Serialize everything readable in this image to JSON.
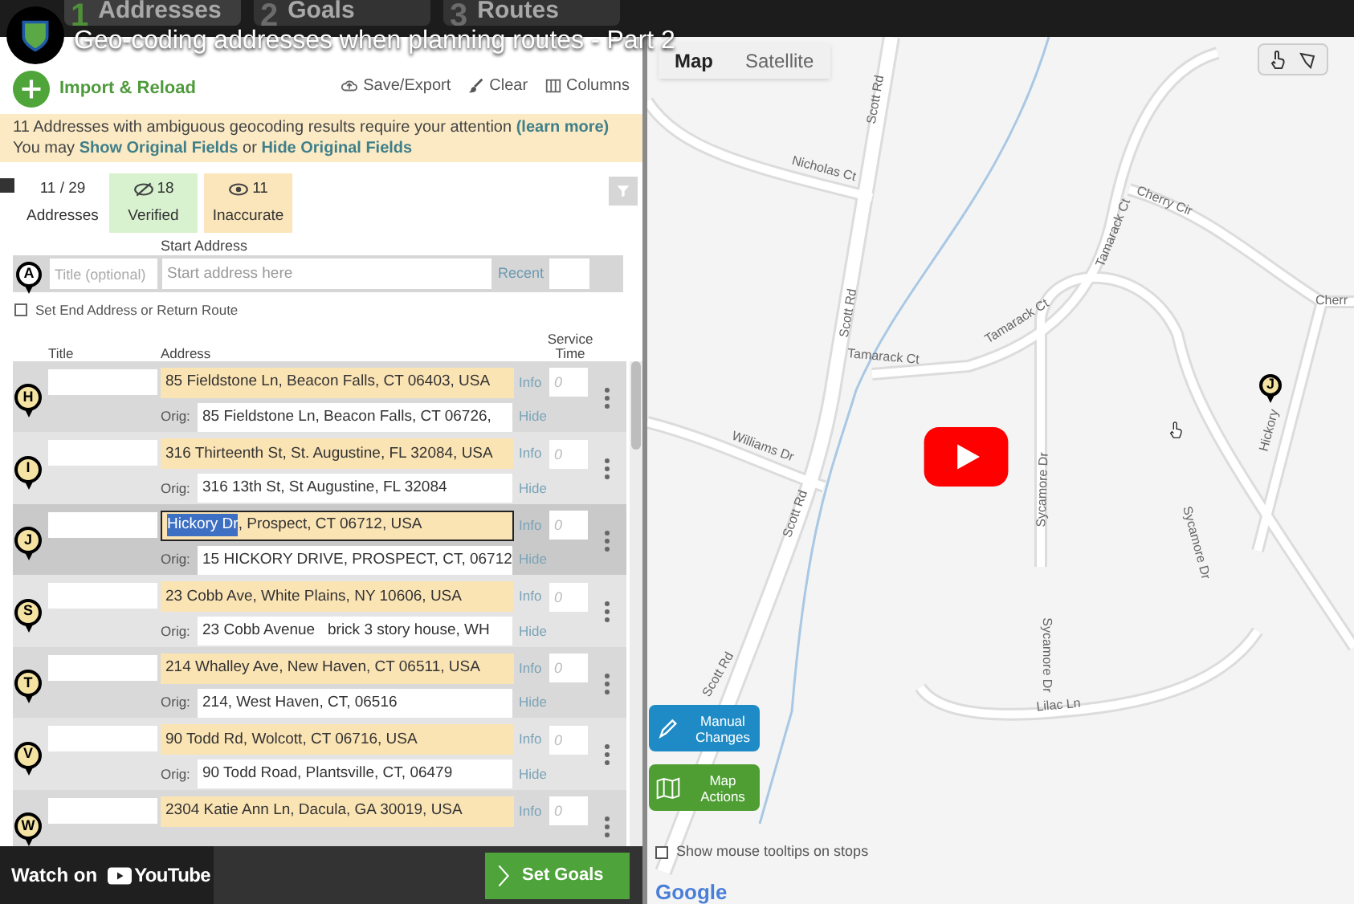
{
  "video": {
    "title": "Geo-coding addresses when planning routes - Part 2",
    "watch_label": "Watch on",
    "platform": "YouTube"
  },
  "steps": [
    {
      "number": "1",
      "label": "Addresses",
      "selected": true
    },
    {
      "number": "2",
      "label": "Goals",
      "selected": false
    },
    {
      "number": "3",
      "label": "Routes",
      "selected": false
    }
  ],
  "toolbar": {
    "import": "Import & Reload",
    "save": "Save/Export",
    "clear": "Clear",
    "columns": "Columns"
  },
  "notice": {
    "line1": "11 Addresses with ambiguous geocoding results require your attention",
    "learn_more": "(learn more)",
    "line2_prefix": "You may",
    "show_link": "Show Original Fields",
    "joiner": "or",
    "hide_link": "Hide Original Fields"
  },
  "summary": {
    "count": "11 / 29",
    "count_label": "Addresses",
    "verified": "18",
    "verified_label": "Verified",
    "inaccurate": "11",
    "inaccurate_label": "Inaccurate"
  },
  "start": {
    "heading": "Start Address",
    "pin": "A",
    "title_placeholder": "Title (optional)",
    "address_placeholder": "Start address here",
    "recent": "Recent"
  },
  "end_option": {
    "label": "Set End Address or Return Route",
    "checked": false
  },
  "columns": [
    "Title",
    "Address",
    "Service Time"
  ],
  "stops": [
    {
      "letter": "H",
      "focused": false,
      "address_parts": [
        {
          "text": "85 Fieldstone Ln, Beacon Falls, CT 06403, USA",
          "selected": false
        }
      ],
      "info": "Info",
      "service_time": "0",
      "orig_label": "Orig:",
      "orig": "85 Fieldstone Ln, Beacon Falls, CT 06726,",
      "hide": "Hide"
    },
    {
      "letter": "I",
      "focused": false,
      "address_parts": [
        {
          "text": "316 Thirteenth St, St. Augustine, FL 32084, USA",
          "selected": false
        }
      ],
      "info": "Info",
      "service_time": "0",
      "orig_label": "Orig:",
      "orig": "316 13th St, St Augustine, FL 32084",
      "hide": "Hide"
    },
    {
      "letter": "J",
      "focused": true,
      "address_parts": [
        {
          "text": "Hickory Dr",
          "selected": true
        },
        {
          "text": ", Prospect, CT 06712, USA",
          "selected": false
        }
      ],
      "info": "Info",
      "service_time": "0",
      "orig_label": "Orig:",
      "orig": "15 HICKORY DRIVE, PROSPECT, CT, 06712",
      "hide": "Hide"
    },
    {
      "letter": "S",
      "focused": false,
      "address_parts": [
        {
          "text": "23 Cobb Ave, White Plains, NY 10606, USA",
          "selected": false
        }
      ],
      "info": "Info",
      "service_time": "0",
      "orig_label": "Orig:",
      "orig": "23 Cobb Avenue   brick 3 story house, WH",
      "hide": "Hide"
    },
    {
      "letter": "T",
      "focused": false,
      "address_parts": [
        {
          "text": "214 Whalley Ave, New Haven, CT 06511, USA",
          "selected": false
        }
      ],
      "info": "Info",
      "service_time": "0",
      "orig_label": "Orig:",
      "orig": "214, West Haven, CT, 06516",
      "hide": "Hide"
    },
    {
      "letter": "V",
      "focused": false,
      "address_parts": [
        {
          "text": "90 Todd Rd, Wolcott, CT 06716, USA",
          "selected": false
        }
      ],
      "info": "Info",
      "service_time": "0",
      "orig_label": "Orig:",
      "orig": "90 Todd Road, Plantsville, CT, 06479",
      "hide": "Hide"
    },
    {
      "letter": "W",
      "focused": false,
      "address_parts": [
        {
          "text": "2304 Katie Ann Ln, Dacula, GA 30019, USA",
          "selected": false
        }
      ],
      "info": "Info",
      "service_time": "0"
    }
  ],
  "set_goals": "Set Goals",
  "map": {
    "types": [
      {
        "label": "Map",
        "selected": true
      },
      {
        "label": "Satellite",
        "selected": false
      }
    ],
    "street_labels": [
      "Scott Rd",
      "Scott Rd",
      "Scott Rd",
      "Scott Rd",
      "Nicholas Ct",
      "Cherry Cir",
      "Tamarack Ct",
      "Tamarack Ct",
      "Tamarack Ct",
      "Cherr",
      "Hickory",
      "Williams Dr",
      "Sycamore Dr",
      "Sycamore Dr",
      "Sycamore Dr",
      "Lilac Ln"
    ],
    "marker": "J",
    "manual_changes": "Manual Changes",
    "map_actions": "Map Actions",
    "tooltips_option": {
      "label": "Show mouse tooltips on stops",
      "checked": false
    },
    "attribution": "Google"
  }
}
